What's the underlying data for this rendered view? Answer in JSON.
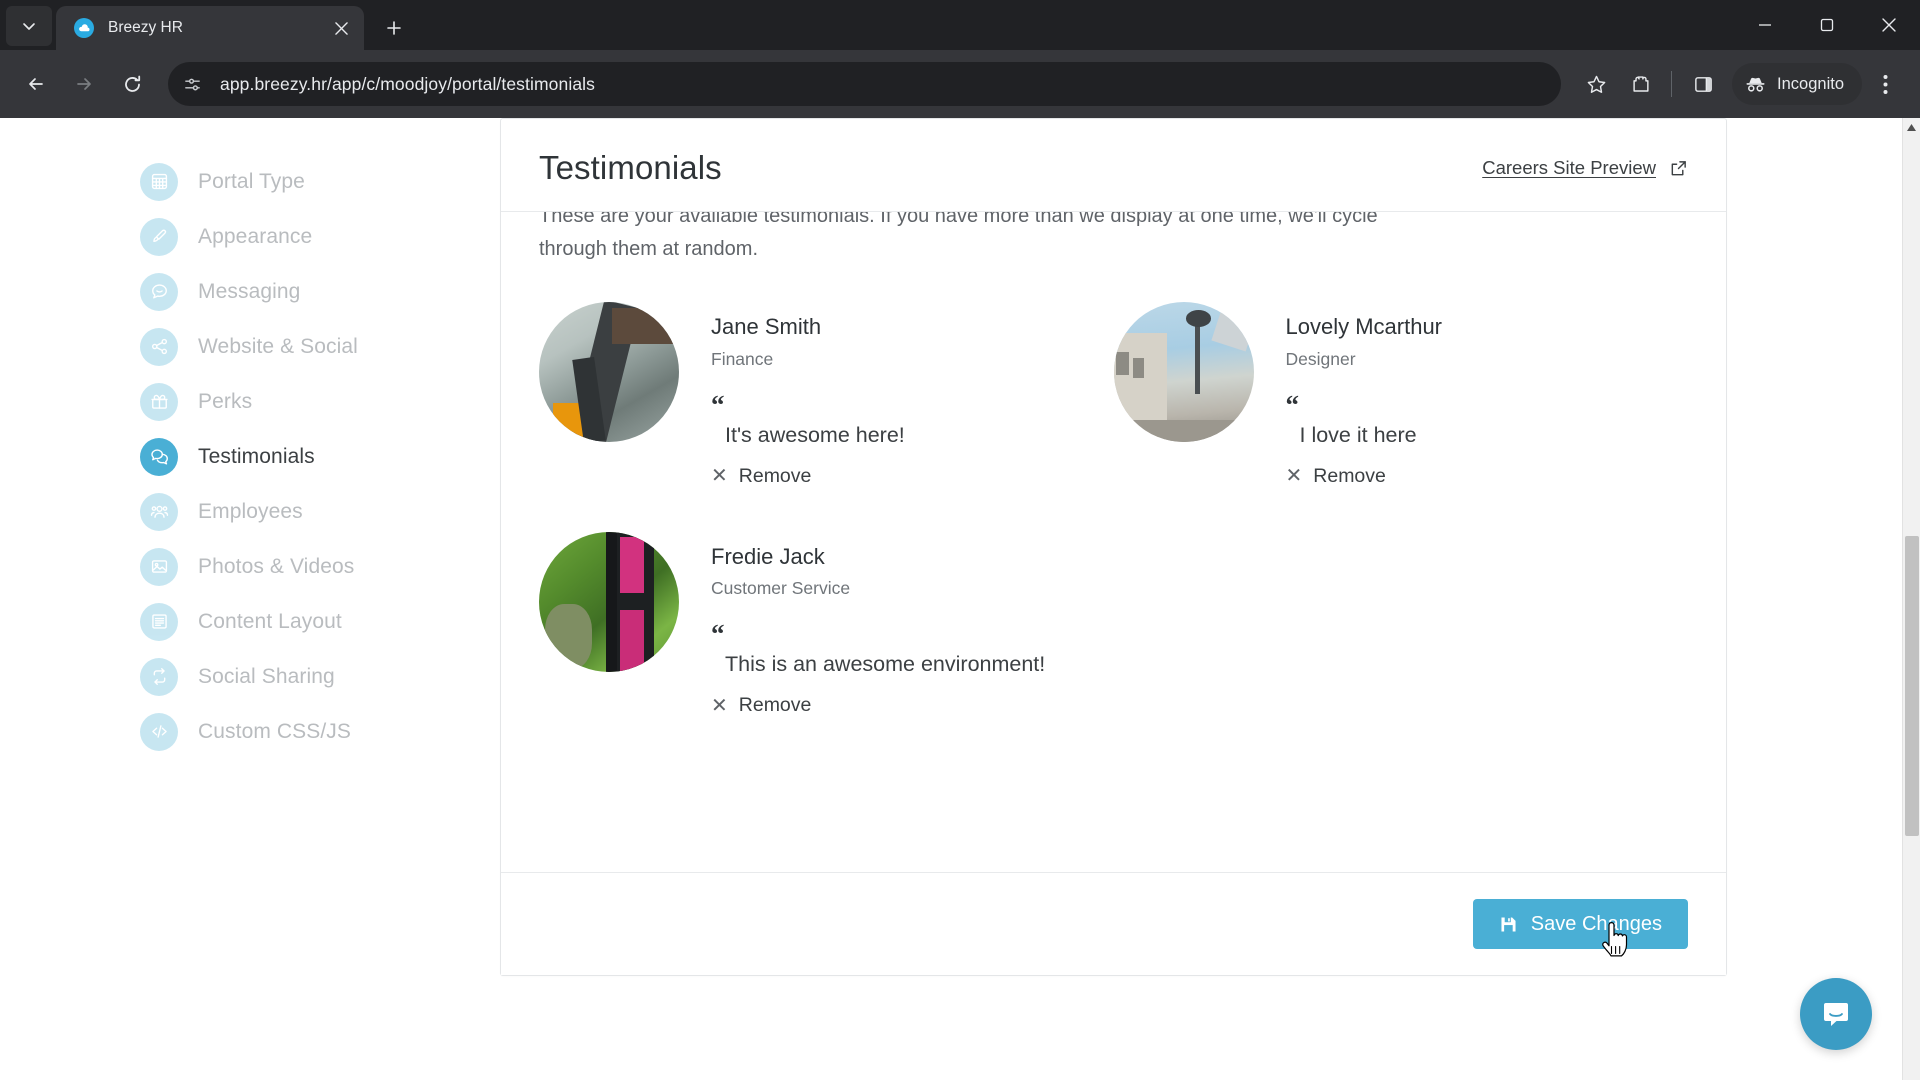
{
  "browser": {
    "tab": {
      "title": "Breezy HR",
      "favicon": "cloud-icon",
      "close": "×"
    },
    "new_tab_label": "+",
    "url": "app.breezy.hr/app/c/moodjoy/portal/testimonials",
    "profile_label": "Incognito",
    "window_controls": {
      "minimize": "minimize-icon",
      "maximize": "maximize-icon",
      "close": "close-icon"
    },
    "toolbar_icons": [
      "back-icon",
      "forward-icon",
      "reload-icon",
      "site-settings-icon",
      "bookmark-star-icon",
      "extensions-icon",
      "side-panel-icon",
      "incognito-icon",
      "chrome-menu-icon"
    ]
  },
  "sidebar": {
    "items": [
      {
        "label": "Portal Type",
        "icon": "grid-icon",
        "active": false
      },
      {
        "label": "Appearance",
        "icon": "brush-icon",
        "active": false
      },
      {
        "label": "Messaging",
        "icon": "chat-icon",
        "active": false
      },
      {
        "label": "Website & Social",
        "icon": "share-icon",
        "active": false
      },
      {
        "label": "Perks",
        "icon": "gift-icon",
        "active": false
      },
      {
        "label": "Testimonials",
        "icon": "quotes-chat-icon",
        "active": true
      },
      {
        "label": "Employees",
        "icon": "people-icon",
        "active": false
      },
      {
        "label": "Photos & Videos",
        "icon": "image-icon",
        "active": false
      },
      {
        "label": "Content Layout",
        "icon": "list-icon",
        "active": false
      },
      {
        "label": "Social Sharing",
        "icon": "retweet-icon",
        "active": false
      },
      {
        "label": "Custom CSS/JS",
        "icon": "code-icon",
        "active": false
      }
    ]
  },
  "main": {
    "title": "Testimonials",
    "preview_link": "Careers Site Preview",
    "preview_icon": "external-link-icon",
    "intro": "These are your available testimonials. If you have more than we display at one time, we'll cycle through them at random.",
    "quote_mark": "“",
    "testimonials": [
      {
        "name": "Jane Smith",
        "role": "Finance",
        "quote": "It's awesome here!",
        "remove_label": "Remove",
        "avatar": "construction-photo"
      },
      {
        "name": "Lovely Mcarthur",
        "role": "Designer",
        "quote": "I love it here",
        "remove_label": "Remove",
        "avatar": "city-street-photo"
      },
      {
        "name": "Fredie Jack",
        "role": "Customer Service",
        "quote": "This is an awesome environment!",
        "remove_label": "Remove",
        "avatar": "forest-sign-photo"
      }
    ],
    "save_button": {
      "label": "Save Changes",
      "icon": "save-disk-icon",
      "color": "#4aafd5"
    }
  },
  "chat": {
    "icon": "intercom-chat-icon",
    "color": "#3b9cc4"
  },
  "scrollbar": {
    "position": "right",
    "thumb_top_pct": 62
  }
}
